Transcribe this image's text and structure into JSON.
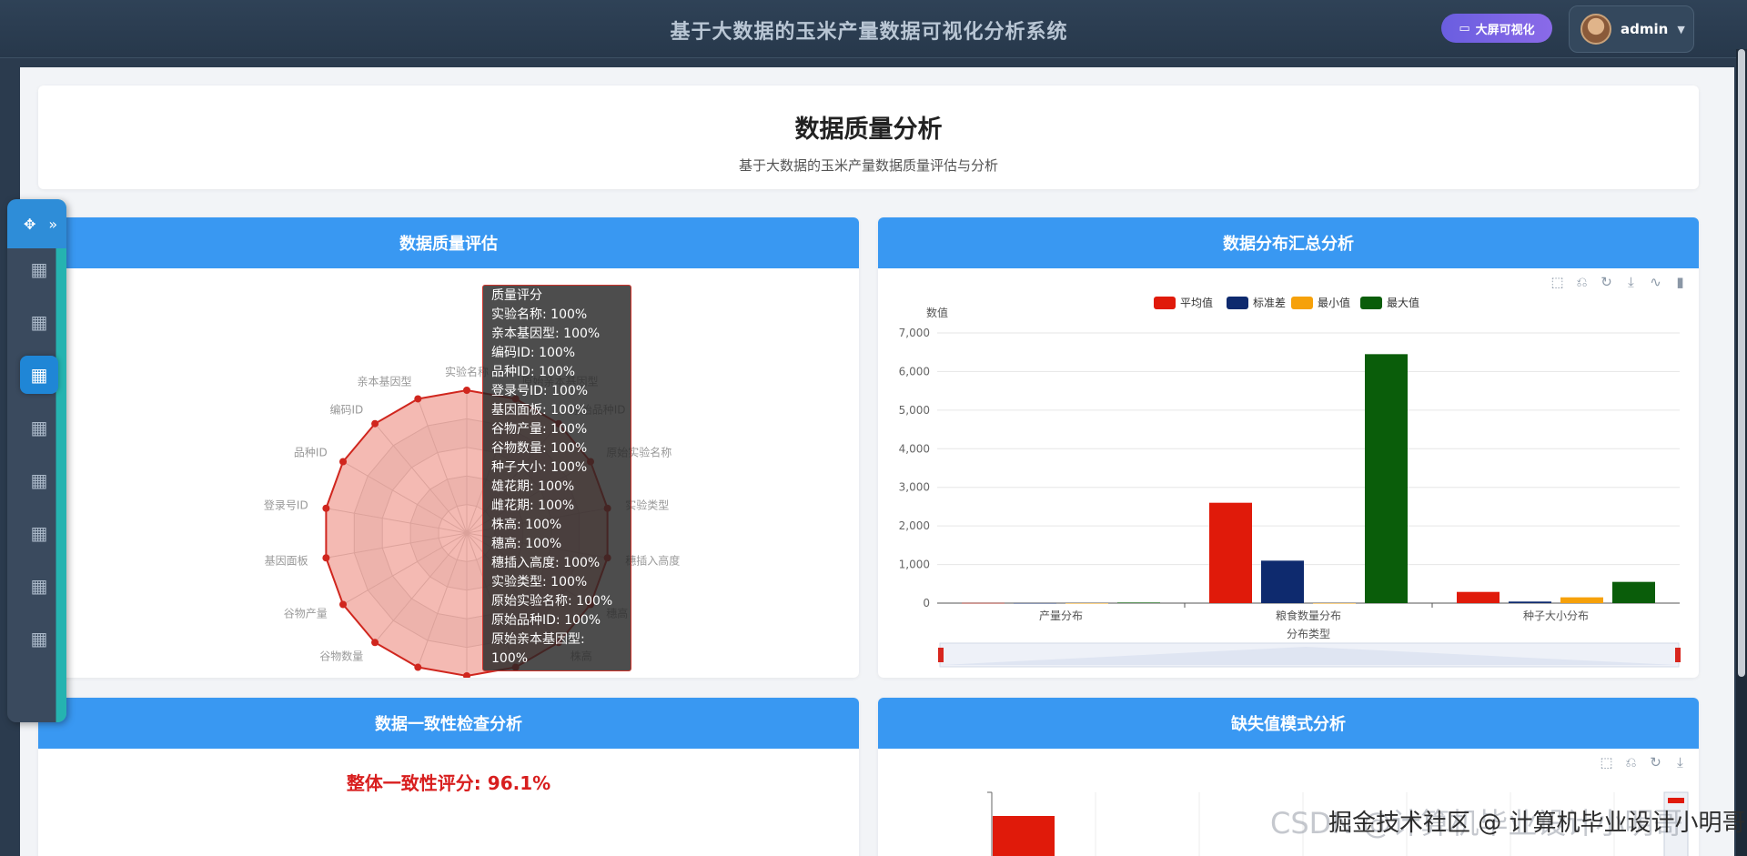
{
  "topbar": {
    "title": "基于大数据的玉米产量数据可视化分析系统",
    "bigscreen_label": "大屏可视化",
    "user_name": "admin"
  },
  "header": {
    "title": "数据质量分析",
    "subtitle": "基于大数据的玉米产量数据质量评估与分析"
  },
  "panels": {
    "quality": {
      "title": "数据质量评估"
    },
    "distribution": {
      "title": "数据分布汇总分析"
    },
    "consistency": {
      "title": "数据一致性检查分析",
      "score_text": "整体一致性评分: 96.1%"
    },
    "missing": {
      "title": "缺失值模式分析"
    }
  },
  "tooltip": {
    "title": "质量评分",
    "lines": [
      "实验名称: 100%",
      "亲本基因型: 100%",
      "编码ID: 100%",
      "品种ID: 100%",
      "登录号ID: 100%",
      "基因面板: 100%",
      "谷物产量: 100%",
      "谷物数量: 100%",
      "种子大小: 100%",
      "雄花期: 100%",
      "雌花期: 100%",
      "株高: 100%",
      "穗高: 100%",
      "穗插入高度: 100%",
      "实验类型: 100%",
      "原始实验名称: 100%",
      "原始品种ID: 100%",
      "原始亲本基因型: 100%"
    ]
  },
  "chart_data": [
    {
      "type": "radar",
      "title": "",
      "series_name": "质量评分",
      "indicators": [
        "实验名称",
        "原始亲本基因型",
        "原始品种ID",
        "原始实验名称",
        "实验类型",
        "穗插入高度",
        "穗高",
        "株高",
        "雌花期",
        "雄花期",
        "种子大小",
        "谷物数量",
        "谷物产量",
        "基因面板",
        "登录号ID",
        "品种ID",
        "编码ID",
        "亲本基因型"
      ],
      "values": [
        100,
        100,
        100,
        100,
        100,
        100,
        100,
        100,
        100,
        100,
        100,
        100,
        100,
        100,
        100,
        100,
        100,
        100
      ],
      "max": 100
    },
    {
      "type": "bar",
      "title": "",
      "categories": [
        "产量分布",
        "粮食数量分布",
        "种子大小分布"
      ],
      "series": [
        {
          "name": "平均值",
          "values": [
            5,
            2600,
            290
          ]
        },
        {
          "name": "标准差",
          "values": [
            2,
            1100,
            40
          ]
        },
        {
          "name": "最小值",
          "values": [
            0,
            0,
            150
          ]
        },
        {
          "name": "最大值",
          "values": [
            15,
            6450,
            550
          ]
        }
      ],
      "xlabel": "分布类型",
      "ylabel": "数值",
      "ylim": [
        0,
        7000
      ],
      "yticks": [
        "0",
        "1,000",
        "2,000",
        "3,000",
        "4,000",
        "5,000",
        "6,000",
        "7,000"
      ],
      "legend_position": "top-center",
      "colors": [
        "#e01a0a",
        "#0e2a6e",
        "#f6a10a",
        "#0a5d0a"
      ]
    }
  ],
  "colors": {
    "accent": "#3998f2",
    "score_red": "#d81e1e",
    "radar_line": "#d0261e"
  },
  "nav": {
    "items": [
      "grid-icon",
      "grid-icon",
      "grid-icon",
      "grid-icon",
      "grid-icon",
      "grid-icon",
      "grid-icon",
      "grid-icon"
    ],
    "active_index": 2
  },
  "watermark": {
    "text": "CSDN @计算机毕业设计小明哥",
    "text2": "掘金技术社区 @ 计算机毕业设计小明哥"
  }
}
